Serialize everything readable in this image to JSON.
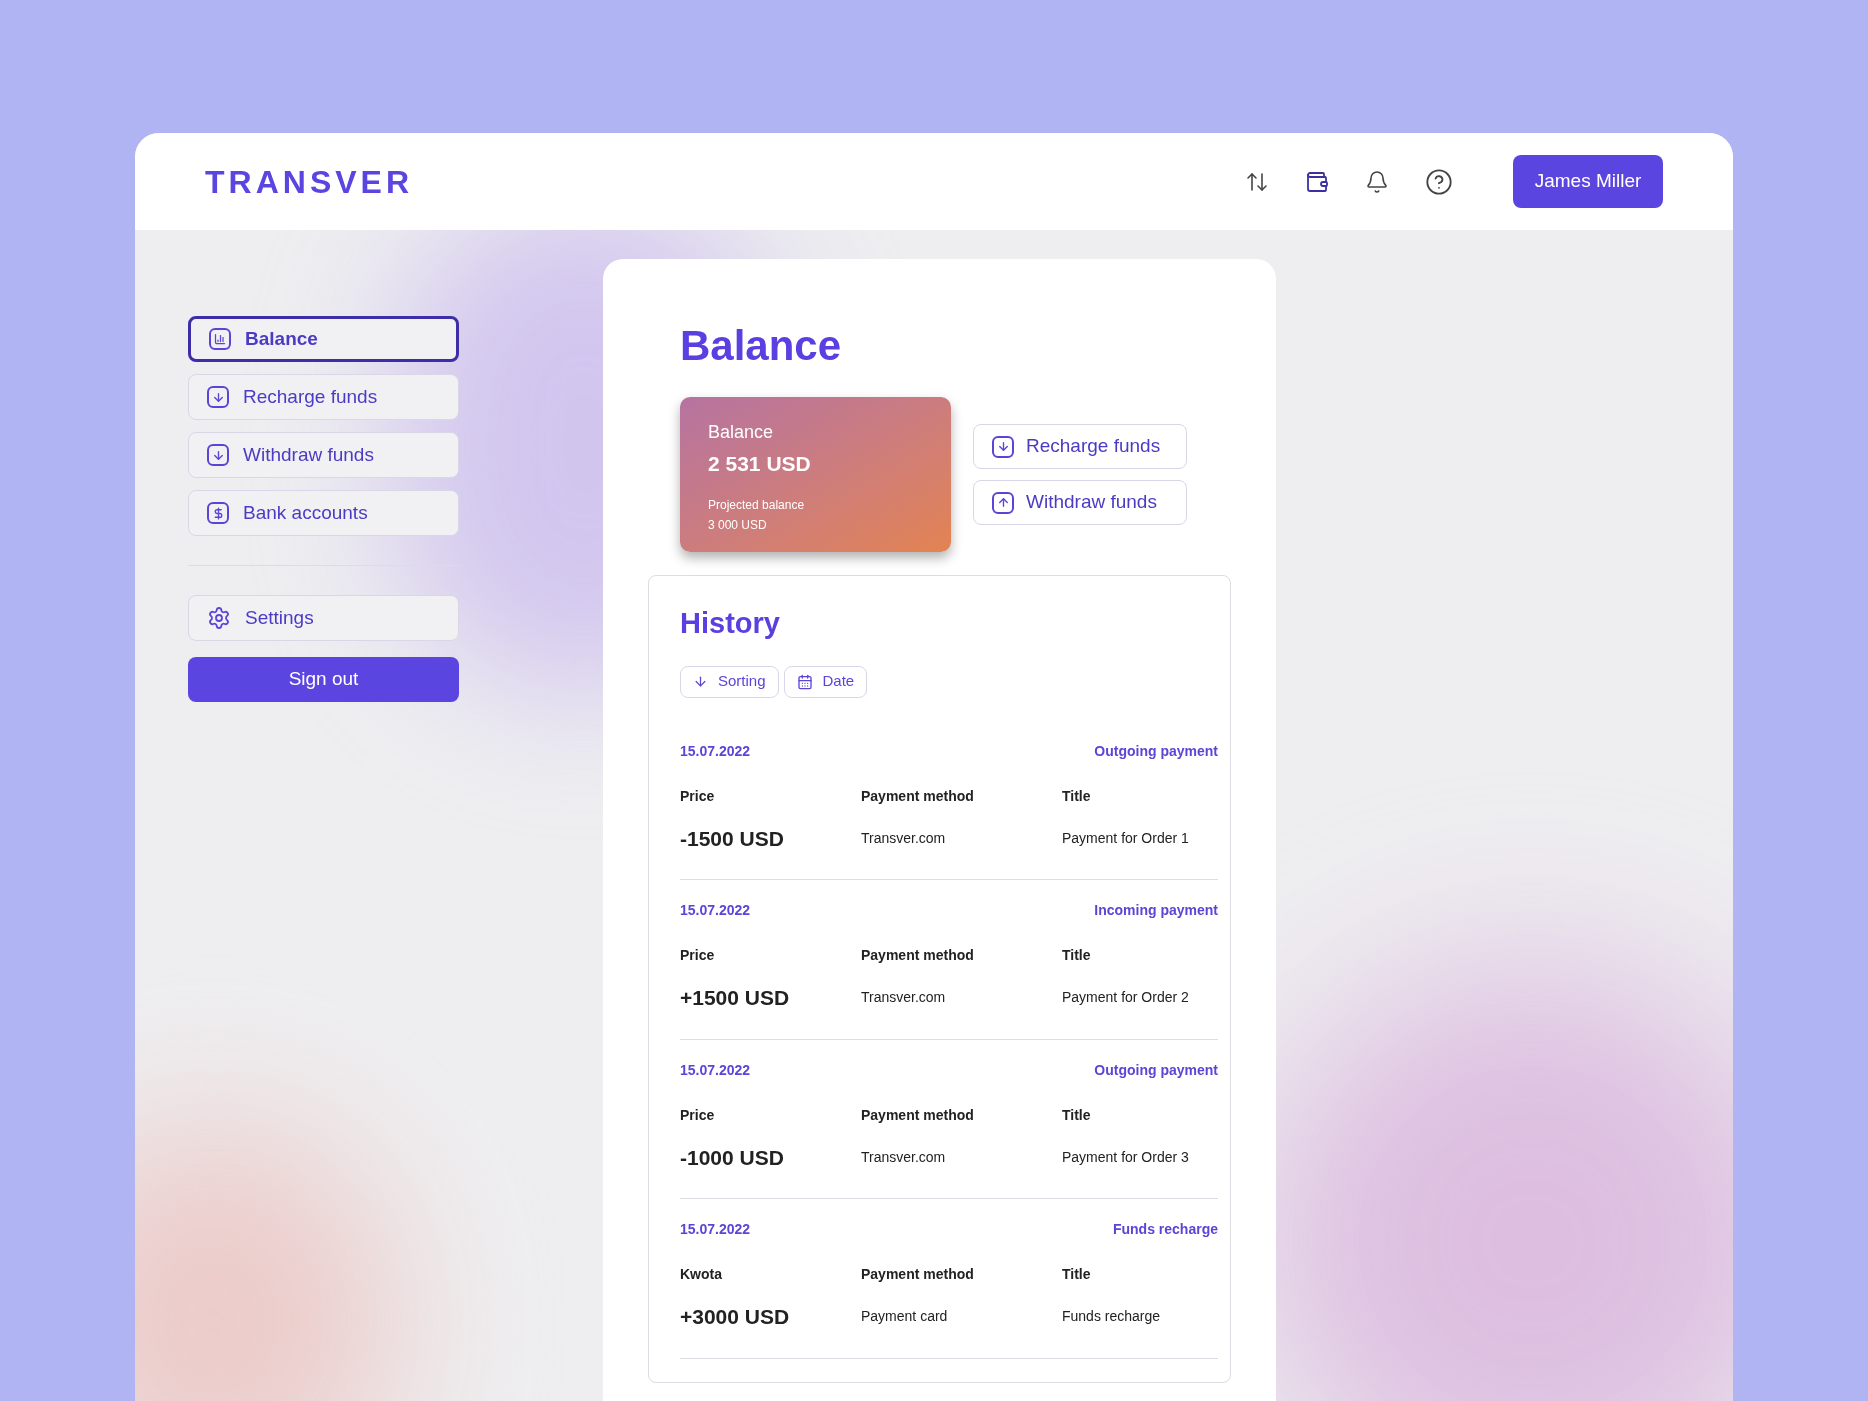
{
  "header": {
    "logo": "TRANSVER",
    "user_button": "James Miller"
  },
  "sidebar": {
    "items": [
      {
        "label": "Balance",
        "selected": true
      },
      {
        "label": "Recharge funds",
        "selected": false
      },
      {
        "label": "Withdraw funds",
        "selected": false
      },
      {
        "label": "Bank accounts",
        "selected": false
      }
    ],
    "settings": "Settings",
    "sign_out": "Sign out"
  },
  "main": {
    "title": "Balance",
    "balance_card": {
      "label": "Balance",
      "amount": "2 531 USD",
      "projected_label": "Projected balance",
      "projected_amount": "3 000 USD"
    },
    "actions": [
      "Recharge funds",
      "Withdraw funds"
    ],
    "history": {
      "title": "History",
      "filters": [
        "Sorting",
        "Date"
      ],
      "entries": [
        {
          "date": "15.07.2022",
          "type": "Outgoing payment",
          "price_label": "Price",
          "method_label": "Payment method",
          "title_label": "Title",
          "amount": "-1500 USD",
          "method": "Transver.com",
          "title": "Payment for Order 1"
        },
        {
          "date": "15.07.2022",
          "type": "Incoming payment",
          "price_label": "Price",
          "method_label": "Payment method",
          "title_label": "Title",
          "amount": "+1500 USD",
          "method": "Transver.com",
          "title": "Payment for Order 2"
        },
        {
          "date": "15.07.2022",
          "type": "Outgoing payment",
          "price_label": "Price",
          "method_label": "Payment method",
          "title_label": "Title",
          "amount": "-1000 USD",
          "method": "Transver.com",
          "title": "Payment for Order 3"
        },
        {
          "date": "15.07.2022",
          "type": "Funds recharge",
          "price_label": "Kwota",
          "method_label": "Payment method",
          "title_label": "Title",
          "amount": "+3000 USD",
          "method": "Payment card",
          "title": "Funds recharge"
        }
      ]
    }
  }
}
